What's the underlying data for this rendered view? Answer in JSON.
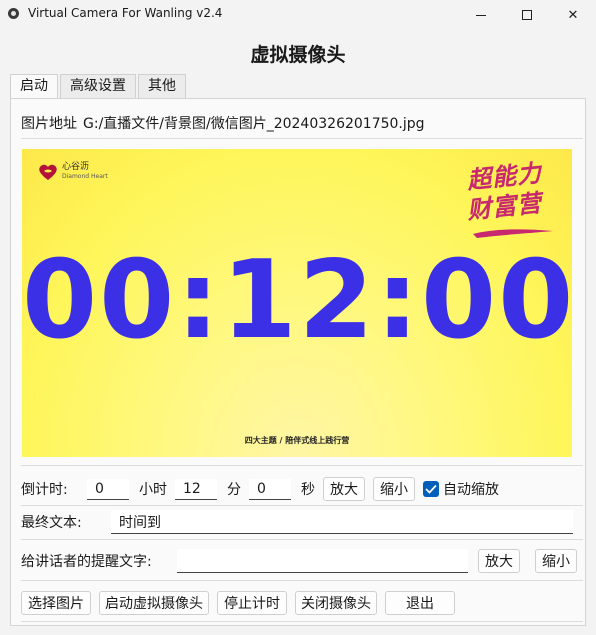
{
  "window": {
    "title": "Virtual Camera For Wanling v2.4",
    "icon": "app-circle-icon",
    "min_icon": "minimize-icon",
    "max_icon": "maximize-icon",
    "close_icon": "close-icon",
    "close_glyph": "✕"
  },
  "heading": "虚拟摄像头",
  "tabs": [
    {
      "label": "启动",
      "active": true
    },
    {
      "label": "高级设置",
      "active": false
    },
    {
      "label": "其他",
      "active": false
    }
  ],
  "image_path": {
    "label": "图片地址",
    "value": "G:/直播文件/背景图/微信图片_20240326201750.jpg"
  },
  "preview": {
    "logo_cn": "心谷沥",
    "logo_en": "Diamond Heart",
    "brand_line1": "超能力",
    "brand_line2": "财富营",
    "timer": "00:12:00",
    "caption": "四大主题 / 陪伴式线上践行营",
    "accent_color": "#3c30e6",
    "brand_color": "#c8286e"
  },
  "countdown": {
    "label": "倒计时:",
    "hours_value": "0",
    "hours_unit": "小时",
    "minutes_value": "12",
    "minutes_unit": "分",
    "seconds_value": "0",
    "seconds_unit": "秒",
    "zoom_in_label": "放大",
    "zoom_out_label": "缩小",
    "auto_scale_label": "自动缩放",
    "auto_scale_checked": true
  },
  "final_text": {
    "label": "最终文本:",
    "value": "时间到"
  },
  "speaker_reminder": {
    "label": "给讲话者的提醒文字:",
    "value": "",
    "zoom_in_label": "放大",
    "zoom_out_label": "缩小"
  },
  "actions": {
    "select_image": "选择图片",
    "start_camera": "启动虚拟摄像头",
    "stop_timer": "停止计时",
    "close_camera": "关闭摄像头",
    "exit": "退出"
  }
}
